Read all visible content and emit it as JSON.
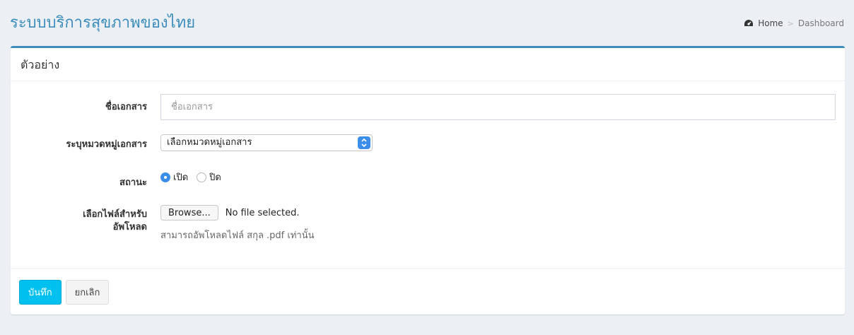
{
  "header": {
    "title": "ระบบบริการสุขภาพของไทย",
    "breadcrumb": {
      "home_label": "Home",
      "separator": ">",
      "current": "Dashboard"
    }
  },
  "card": {
    "title": "ตัวอย่าง",
    "fields": {
      "doc_name": {
        "label": "ชื่อเอกสาร",
        "placeholder": "ชื่อเอกสาร",
        "value": ""
      },
      "category": {
        "label": "ระบุหมวดหมู่เอกสาร",
        "selected": "เลือกหมวดหมู่เอกสาร"
      },
      "status": {
        "label": "สถานะ",
        "options": [
          {
            "label": "เปิด",
            "checked": true
          },
          {
            "label": "ปิด",
            "checked": false
          }
        ]
      },
      "upload": {
        "label_line1": "เลือกไฟล์สำหรับ",
        "label_line2": "อัพโหลด",
        "browse_label": "Browse...",
        "file_status": "No file selected.",
        "help": "สามารถอัพโหลดไฟล์ สกุล .pdf เท่านั้น"
      }
    },
    "footer": {
      "save_label": "บันทึก",
      "cancel_label": "ยกเลิก"
    }
  },
  "colors": {
    "accent": "#3c8dbc",
    "primary_button": "#00c0ef",
    "background": "#ecf0f5"
  },
  "icons": {
    "breadcrumb_home": "dashboard-icon",
    "select_arrows": "updown-chevron-icon"
  }
}
